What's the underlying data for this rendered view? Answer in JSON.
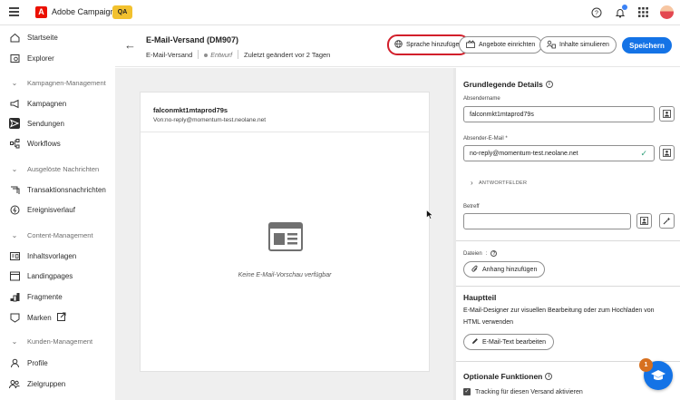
{
  "topbar": {
    "app_title": "Adobe Campaign",
    "env_badge": "QA",
    "logo_letter": "A",
    "icons": [
      "help-icon",
      "bell-icon",
      "apps-grid-icon",
      "avatar"
    ]
  },
  "sidebar": {
    "items": [
      {
        "label": "Startseite",
        "icon": "home-icon"
      },
      {
        "label": "Explorer",
        "icon": "explorer-icon"
      }
    ],
    "sections": [
      {
        "title": "Kampagnen-Management",
        "items": [
          {
            "label": "Kampagnen",
            "icon": "campaign-icon"
          },
          {
            "label": "Sendungen",
            "icon": "send-icon",
            "active": true
          },
          {
            "label": "Workflows",
            "icon": "workflow-icon"
          }
        ]
      },
      {
        "title": "Ausgelöste Nachrichten",
        "items": [
          {
            "label": "Transaktionsnachrichten",
            "icon": "transaction-icon"
          },
          {
            "label": "Ereignisverlauf",
            "icon": "event-history-icon"
          }
        ]
      },
      {
        "title": "Content-Management",
        "items": [
          {
            "label": "Inhaltsvorlagen",
            "icon": "template-icon"
          },
          {
            "label": "Landingpages",
            "icon": "landingpage-icon"
          },
          {
            "label": "Fragmente",
            "icon": "fragment-icon"
          },
          {
            "label": "Marken",
            "icon": "brand-icon"
          }
        ]
      },
      {
        "title": "Kunden-Management",
        "items": [
          {
            "label": "Profile",
            "icon": "profile-icon"
          },
          {
            "label": "Zielgruppen",
            "icon": "audience-icon"
          }
        ]
      }
    ]
  },
  "header": {
    "title": "E-Mail-Versand (DM907)",
    "channel": "E-Mail-Versand",
    "status": "Entwurf",
    "modified": "Zuletzt geändert vor 2 Tagen",
    "btn_language": "Sprache hinzufügen",
    "btn_offers": "Angebote einrichten",
    "btn_simulate": "Inhalte simulieren",
    "btn_save": "Speichern"
  },
  "preview": {
    "sender_name": "falconmkt1mtaprod79s",
    "from_line": "Von:no-reply@momentum-test.neolane.net",
    "empty_text": "Keine E-Mail-Vorschau verfügbar"
  },
  "panel": {
    "basic_details_title": "Grundlegende Details",
    "sender_name_label": "Absendername",
    "sender_name_value": "falconmkt1mtaprod79s",
    "sender_email_label": "Absender-E-Mail",
    "required_mark": "*",
    "sender_email_value": "no-reply@momentum-test.neolane.net",
    "reply_fields_label": "ANTWORTFELDER",
    "subject_label": "Betreff",
    "subject_value": "",
    "files_label": "Dateien",
    "add_attachment": "Anhang hinzufügen",
    "main_title": "Hauptteil",
    "main_desc": "E-Mail-Designer zur visuellen Bearbeitung oder zum Hochladen von HTML verwenden",
    "edit_email_btn": "E-Mail-Text bearbeiten",
    "optional_title": "Optionale Funktionen",
    "tracking_label": "Tracking für diesen Versand aktivieren"
  },
  "help": {
    "badge_count": "1"
  },
  "colors": {
    "accent": "#1473e6",
    "highlight_ring": "#d21f2b",
    "qa_badge": "#f2c12e",
    "brand": "#eb1000"
  }
}
